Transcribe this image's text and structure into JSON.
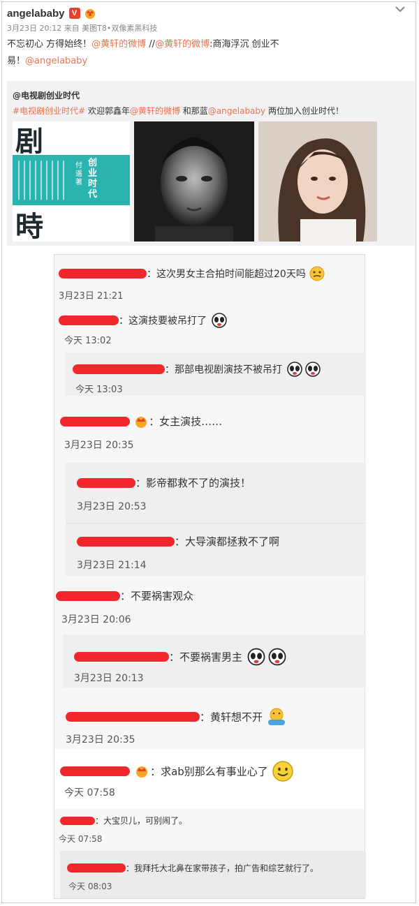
{
  "post": {
    "username": "angelababy",
    "verified_badge": "V",
    "meta": "3月23日 20:12 来自 美图T8•双像素黑科技",
    "text_parts": {
      "p1": "不忘初心 方得始终！",
      "l1": "@黄轩的微博",
      "p2": " //",
      "l2": "@黄轩的微博",
      "p3": ":商海浮沉 创业不",
      "p4": "易！",
      "l3": "@angelababy"
    }
  },
  "repost": {
    "author": "@电视剧创业时代",
    "hashtag": "#电视剧创业时代#",
    "t1": " 欢迎郭鑫年",
    "l1": "@黄轩的微博",
    "t2": " 和那蓝",
    "l2": "@angelababy",
    "t3": " 两位加入创业时代！",
    "cover": {
      "top": "剧 業",
      "title": "创业时代",
      "author": "付遥 著",
      "bottom": "時 代"
    }
  },
  "comments": [
    {
      "text": "：这次男女主合拍时间能超过20天吗",
      "time": "3月23日 21:21"
    },
    {
      "text": "：这演技要被吊打了",
      "time": "今天 13:02"
    },
    {
      "text": "：那部电视剧演技不被吊打",
      "time": "今天 13:03"
    },
    {
      "text": "：女主演技……",
      "time": "3月23日 20:35"
    },
    {
      "text": "：影帝都救不了的演技！",
      "time": "3月23日 20:53"
    },
    {
      "text": "：大导演都拯救不了啊",
      "time": "3月23日 21:14"
    },
    {
      "text": "：不要祸害观众",
      "time": "3月23日 20:06"
    },
    {
      "text": "：不要祸害男主",
      "time": "3月23日 20:13"
    },
    {
      "text": "：黄轩想不开",
      "time": "3月23日 20:35"
    },
    {
      "text": "：求ab别那么有事业心了",
      "time": "今天 07:58"
    },
    {
      "text": "：大宝贝儿，可别闹了。",
      "time": "今天 07:58"
    },
    {
      "text": "：我拜托大北鼻在家带孩子，拍广告和综艺就行了。",
      "time": "今天 08:03"
    }
  ],
  "colors": {
    "link": "#eb7350",
    "redaction": "#f0282c",
    "badge": "#e8402f"
  }
}
